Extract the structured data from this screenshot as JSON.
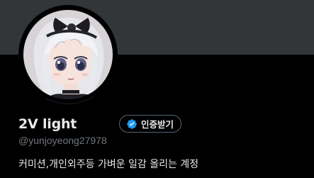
{
  "profile": {
    "display_name": "2V light",
    "handle": "@yunjoyeong27978",
    "bio": "커미션,개인외주등 가벼운 일감 올리는 계정",
    "verify_button_label": "인증받기",
    "avatar_icon": "anime-avatar-image",
    "verify_icon": "verified-badge-icon"
  },
  "colors": {
    "background": "#000000",
    "banner": "#333639",
    "text_primary": "#e7e9ea",
    "text_secondary": "#71767b",
    "verified_blue": "#1d9bf0",
    "button_border": "#536471"
  }
}
